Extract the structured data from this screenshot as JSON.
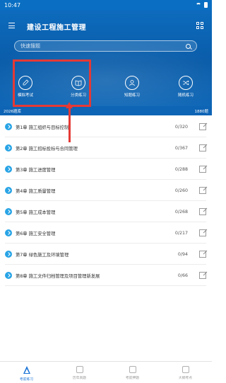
{
  "status_bar": {
    "time": "10:47"
  },
  "header": {
    "title": "建设工程施工管理"
  },
  "search": {
    "placeholder": "快速搜题"
  },
  "features": [
    {
      "label": "模拟考试",
      "icon": "pencil-icon"
    },
    {
      "label": "分类练习",
      "icon": "book-icon"
    },
    {
      "label": "知题练习",
      "icon": "person-icon"
    },
    {
      "label": "随机练习",
      "icon": "shuffle-icon"
    }
  ],
  "count_bar": {
    "left": "2026题库",
    "right": "1880题"
  },
  "chapters": [
    {
      "label": "第1章 施工组织与目标控制",
      "count": "0/320"
    },
    {
      "label": "第2章 施工招标投标与合同管理",
      "count": "0/367"
    },
    {
      "label": "第3章 施工进度管理",
      "count": "0/288"
    },
    {
      "label": "第4章 施工质量管理",
      "count": "0/260"
    },
    {
      "label": "第5章 施工成本管理",
      "count": "0/268"
    },
    {
      "label": "第6章 施工安全管理",
      "count": "0/217"
    },
    {
      "label": "第7章 绿色施工及环境管理",
      "count": "0/94"
    },
    {
      "label": "第8章 施工文件归档管理及项目管理新发展",
      "count": "0/66"
    }
  ],
  "bottom_nav": [
    {
      "label": "考前练习",
      "active": true
    },
    {
      "label": "历年真题",
      "active": false
    },
    {
      "label": "考前押题",
      "active": false
    },
    {
      "label": "大纲考点",
      "active": false
    }
  ],
  "colors": {
    "primary": "#0a5ca9",
    "accent_arrow": "#e53935",
    "chapter_icon": "#28a4e6"
  }
}
